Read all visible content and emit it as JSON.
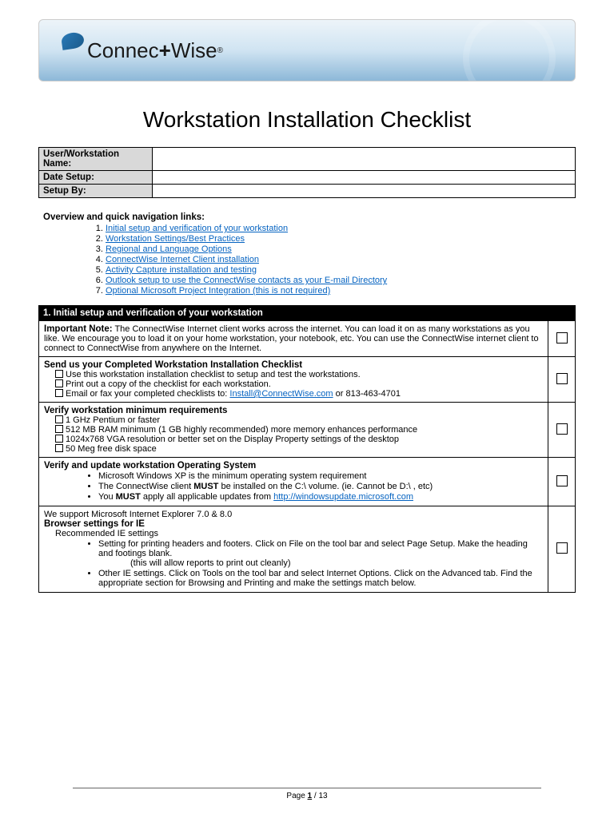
{
  "brand": {
    "name_pre": "Connec",
    "name_plus": "+",
    "name_post": "Wise",
    "tm": "®"
  },
  "title": "Workstation Installation Checklist",
  "meta": {
    "row1_label": "User/Workstation Name:",
    "row2_label": "Date Setup:",
    "row3_label": "Setup By:"
  },
  "overview": {
    "title": "Overview and quick navigation links:",
    "links": [
      "Initial setup and verification of your workstation",
      "Workstation Settings/Best Practices",
      "Regional and Language Options",
      "ConnectWise Internet Client installation",
      "Activity Capture installation and testing",
      "Outlook setup to use the ConnectWise contacts as your E-mail Directory",
      "Optional Microsoft Project Integration (this is not required)"
    ]
  },
  "section1": {
    "head": "1. Initial setup and verification of your workstation",
    "note_label": "Important Note:",
    "note_text": " The ConnectWise Internet client works across the internet. You can load it on as many workstations as you like. We encourage you to load it on your home workstation, your notebook, etc.  You can use the ConnectWise internet client to connect to ConnectWise from anywhere on the Internet.",
    "send_title": "Send us your Completed Workstation Installation Checklist",
    "send_item1": "Use this workstation installation checklist to setup and test the workstations.",
    "send_item2": "Print out a copy of the checklist for each workstation.",
    "send_item3_pre": "Email or fax your completed checklists to: ",
    "send_item3_link": "Install@ConnectWise.com",
    "send_item3_post": " or 813-463-4701",
    "req_title": "Verify workstation minimum requirements",
    "req_item1": "1 GHz Pentium or faster",
    "req_item2": "512 MB RAM minimum (1 GB highly recommended) more memory enhances performance",
    "req_item3": "1024x768 VGA resolution or better set on the Display Property settings of the desktop",
    "req_item4": "50 Meg free disk space",
    "os_title": "Verify and update workstation Operating System",
    "os_bullet1": "Microsoft Windows XP is the minimum operating system requirement",
    "os_bullet2_pre": "The ConnectWise client ",
    "os_bullet2_must": "MUST",
    "os_bullet2_post": " be installed on the C:\\ volume.  (ie. Cannot be D:\\ , etc)",
    "os_bullet3_pre": "You ",
    "os_bullet3_must": "MUST",
    "os_bullet3_post": " apply all applicable updates from ",
    "os_bullet3_link": "http://windowsupdate.microsoft.com",
    "ie_pre": "We support Microsoft Internet Explorer 7.0 & 8.0",
    "ie_title": "Browser settings for IE",
    "ie_sub": "Recommended IE settings",
    "ie_bullet1": "Setting for printing headers and footers. Click on File on the tool bar and select Page Setup.  Make the heading and footings blank.",
    "ie_bullet1_note": "(this will allow reports to print out cleanly)",
    "ie_bullet2": " Other IE settings. Click on Tools on the tool bar and select Internet Options. Click on the Advanced tab. Find the appropriate section for Browsing and Printing and make the settings match below."
  },
  "footer": {
    "label": "Page ",
    "page": "1",
    "sep": " / ",
    "total": "13"
  }
}
